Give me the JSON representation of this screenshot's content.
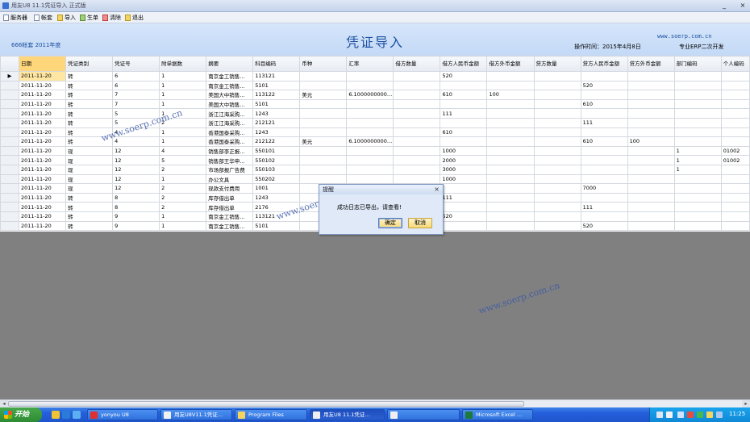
{
  "window": {
    "title": "用友U8 11.1凭证导入 正式版",
    "min": "_",
    "close": "×"
  },
  "toolbar": {
    "items": [
      "服务器",
      "帐套",
      "导入",
      "生单",
      "清除",
      "退出"
    ]
  },
  "header": {
    "account": "666帐套 2011年度",
    "page_title": "凭证导入",
    "op_time": "操作时间：2015年4月8日",
    "site": "www.soerp.com.cn",
    "dev": "专业ERP二次开发"
  },
  "columns": [
    "日期",
    "凭证类别",
    "凭证号",
    "附单据数",
    "摘要",
    "科目编码",
    "币种",
    "汇率",
    "借方数量",
    "借方人民币金额",
    "借方外币金额",
    "贷方数量",
    "贷方人民币金额",
    "贷方外币金额",
    "部门编码",
    "个人编码"
  ],
  "rows": [
    [
      "2011-11-20",
      "转",
      "6",
      "1",
      "南京金工销售…",
      "113121",
      "",
      "",
      "",
      "520",
      "",
      "",
      "",
      "",
      "",
      ""
    ],
    [
      "2011-11-20",
      "转",
      "6",
      "1",
      "南京金工销售…",
      "5101",
      "",
      "",
      "",
      "",
      "",
      "",
      "520",
      "",
      "",
      ""
    ],
    [
      "2011-11-20",
      "转",
      "7",
      "1",
      "美国大中销售…",
      "113122",
      "美元",
      "6.1000000000…",
      "",
      "610",
      "100",
      "",
      "",
      "",
      "",
      ""
    ],
    [
      "2011-11-20",
      "转",
      "7",
      "1",
      "美国大中销售…",
      "5101",
      "",
      "",
      "",
      "",
      "",
      "",
      "610",
      "",
      "",
      ""
    ],
    [
      "2011-11-20",
      "转",
      "5",
      "1",
      "浙江江海采购…",
      "1243",
      "",
      "",
      "",
      "111",
      "",
      "",
      "",
      "",
      "",
      ""
    ],
    [
      "2011-11-20",
      "转",
      "5",
      "2",
      "浙江江海采购…",
      "212121",
      "",
      "",
      "",
      "",
      "",
      "",
      "111",
      "",
      "",
      ""
    ],
    [
      "2011-11-20",
      "转",
      "4",
      "1",
      "香港国泰采购…",
      "1243",
      "",
      "",
      "",
      "610",
      "",
      "",
      "",
      "",
      "",
      ""
    ],
    [
      "2011-11-20",
      "转",
      "4",
      "1",
      "香港国泰采购…",
      "212122",
      "美元",
      "6.1000000000…",
      "",
      "",
      "",
      "",
      "610",
      "100",
      "",
      ""
    ],
    [
      "2011-11-20",
      "现",
      "12",
      "4",
      "销售部李正报…",
      "550101",
      "",
      "",
      "",
      "1000",
      "",
      "",
      "",
      "",
      "1",
      "01002"
    ],
    [
      "2011-11-20",
      "现",
      "12",
      "5",
      "销售部王华申…",
      "550102",
      "",
      "",
      "",
      "2000",
      "",
      "",
      "",
      "",
      "1",
      "01002"
    ],
    [
      "2011-11-20",
      "现",
      "12",
      "2",
      "市场部报广告费",
      "550103",
      "",
      "",
      "",
      "3000",
      "",
      "",
      "",
      "",
      "1",
      ""
    ],
    [
      "2011-11-20",
      "现",
      "12",
      "1",
      "办公文具",
      "550202",
      "",
      "",
      "",
      "1000",
      "",
      "",
      "",
      "",
      "",
      ""
    ],
    [
      "2011-11-20",
      "现",
      "12",
      "2",
      "现款支付费用",
      "1001",
      "",
      "",
      "",
      "",
      "",
      "",
      "7000",
      "",
      "",
      ""
    ],
    [
      "2011-11-20",
      "转",
      "8",
      "2",
      "库存借出单",
      "1243",
      "",
      "",
      "",
      "111",
      "",
      "",
      "",
      "",
      "",
      ""
    ],
    [
      "2011-11-20",
      "转",
      "8",
      "2",
      "库存借出单",
      "2176",
      "",
      "",
      "",
      "",
      "",
      "",
      "111",
      "",
      "",
      ""
    ],
    [
      "2011-11-20",
      "转",
      "9",
      "1",
      "南京金工销售…",
      "113121",
      "",
      "",
      "",
      "520",
      "",
      "",
      "",
      "",
      "",
      ""
    ],
    [
      "2011-11-20",
      "转",
      "9",
      "1",
      "南京金工销售…",
      "5101",
      "",
      "",
      "",
      "",
      "",
      "",
      "520",
      "",
      "",
      ""
    ]
  ],
  "dialog": {
    "title": "提醒",
    "close": "×",
    "message": "成功日志已导出，请查看!",
    "ok": "确定",
    "cancel": "取消"
  },
  "watermark": "www.soerp.com.cn",
  "scrollbar": {
    "left": "◂",
    "right": "▸"
  },
  "taskbar": {
    "start": "开始",
    "tasks": [
      "yonyou U8",
      "用友U8V11.1凭证…",
      "Program Files",
      "用友U8 11.1凭证…",
      "",
      "Microsoft Excel …"
    ],
    "clock": "11:25"
  }
}
